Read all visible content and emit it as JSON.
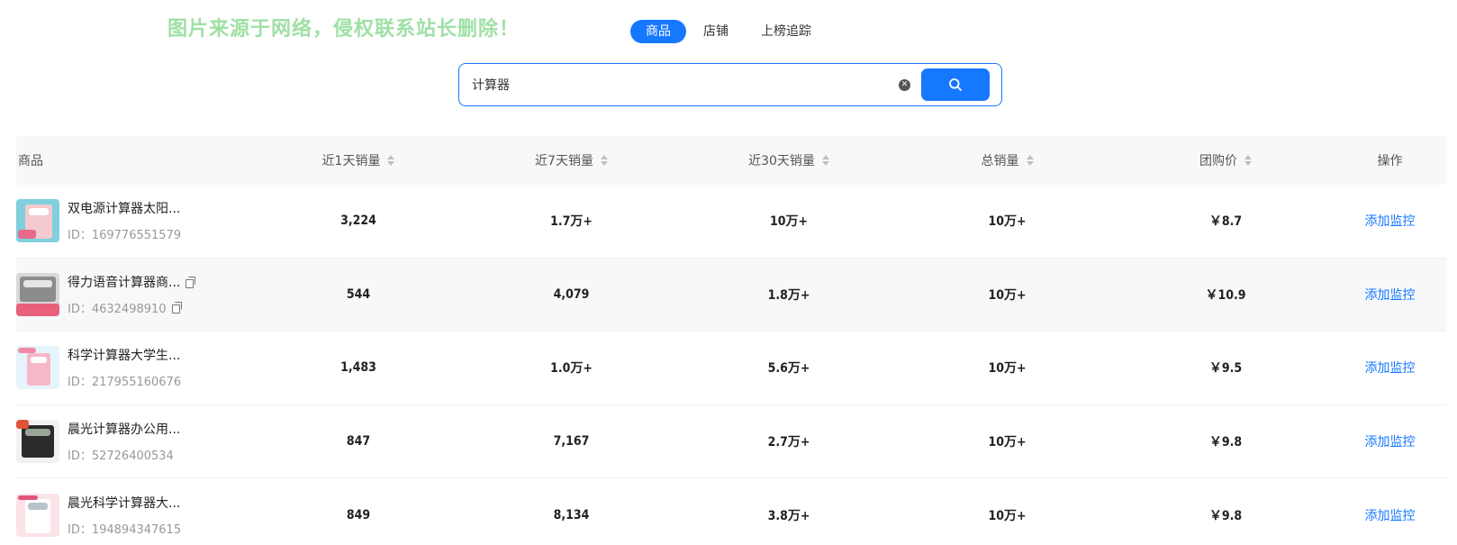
{
  "watermark": "图片来源于网络，侵权联系站长删除！",
  "tabs": [
    {
      "label": "商品",
      "active": true
    },
    {
      "label": "店铺",
      "active": false
    },
    {
      "label": "上榜追踪",
      "active": false
    }
  ],
  "search": {
    "value": "计算器",
    "clear_icon": "close-circle-icon",
    "button_icon": "search-icon"
  },
  "table": {
    "headers": {
      "product": "商品",
      "day1": "近1天销量",
      "day7": "近7天销量",
      "day30": "近30天销量",
      "total": "总销量",
      "price": "团购价",
      "op": "操作"
    },
    "rows": [
      {
        "name": "双电源计算器太阳...",
        "id": "ID：169776551579",
        "day1": "3,224",
        "day7": "1.7万+",
        "day30": "10万+",
        "total": "10万+",
        "price": "￥8.7",
        "op": "添加监控"
      },
      {
        "name": "得力语音计算器商...",
        "id": "ID：4632498910",
        "day1": "544",
        "day7": "4,079",
        "day30": "1.8万+",
        "total": "10万+",
        "price": "￥10.9",
        "op": "添加监控"
      },
      {
        "name": "科学计算器大学生...",
        "id": "ID：217955160676",
        "day1": "1,483",
        "day7": "1.0万+",
        "day30": "5.6万+",
        "total": "10万+",
        "price": "￥9.5",
        "op": "添加监控"
      },
      {
        "name": "晨光计算器办公用...",
        "id": "ID：52726400534",
        "day1": "847",
        "day7": "7,167",
        "day30": "2.7万+",
        "total": "10万+",
        "price": "￥9.8",
        "op": "添加监控"
      },
      {
        "name": "晨光科学计算器大...",
        "id": "ID：194894347615",
        "day1": "849",
        "day7": "8,134",
        "day30": "3.8万+",
        "total": "10万+",
        "price": "￥9.8",
        "op": "添加监控"
      }
    ]
  },
  "colors": {
    "accent": "#1677ff",
    "watermark": "#9fe0a6",
    "row_alt": "#f7f8fa"
  }
}
